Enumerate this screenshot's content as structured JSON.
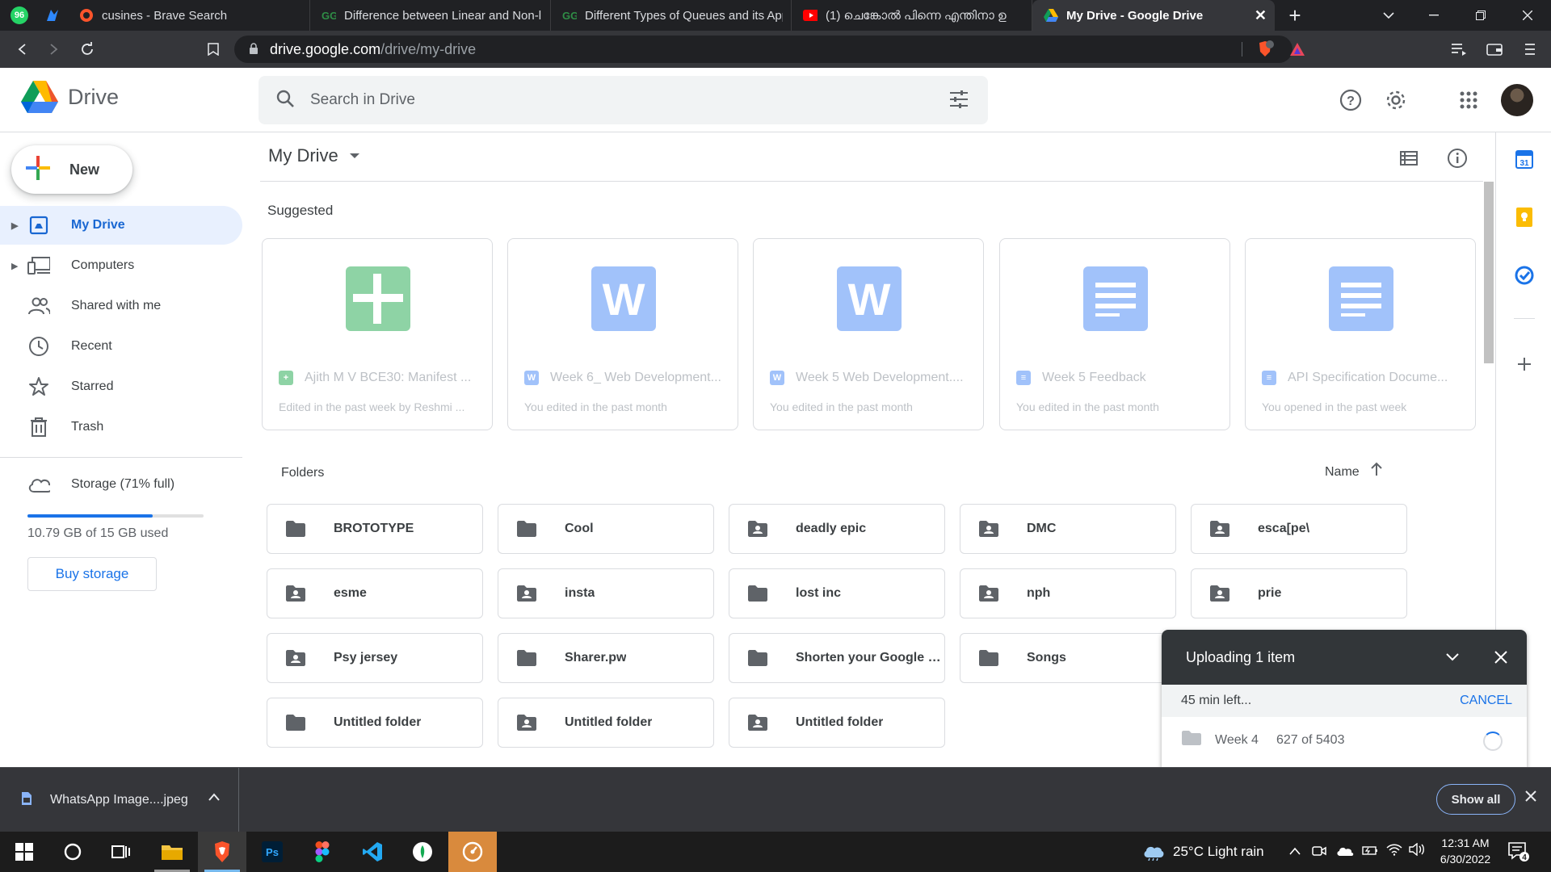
{
  "browser": {
    "tabs": [
      {
        "title": "cusines - Brave Search",
        "icon": "brave-search-icon"
      },
      {
        "title": "Difference between Linear and Non-lin",
        "icon": "gfg-icon"
      },
      {
        "title": "Different Types of Queues and its App",
        "icon": "gfg-icon"
      },
      {
        "title": "(1) ചെങ്കോൽ പിന്നെ എന്തിനാ ഉ",
        "icon": "youtube-icon"
      },
      {
        "title": "My Drive - Google Drive",
        "icon": "drive-icon",
        "active": true
      }
    ],
    "pinned": [
      "whatsapp-icon",
      "messenger-icon"
    ],
    "url_host": "drive.google.com",
    "url_path": "/drive/my-drive",
    "brave_badge": "6"
  },
  "drive": {
    "logo_text": "Drive",
    "search_placeholder": "Search in Drive",
    "new_label": "New",
    "sidebar": [
      {
        "label": "My Drive",
        "icon": "my-drive-icon",
        "active": true,
        "expandable": true
      },
      {
        "label": "Computers",
        "icon": "computers-icon",
        "expandable": true
      },
      {
        "label": "Shared with me",
        "icon": "shared-icon"
      },
      {
        "label": "Recent",
        "icon": "clock-icon"
      },
      {
        "label": "Starred",
        "icon": "star-icon"
      },
      {
        "label": "Trash",
        "icon": "trash-icon"
      }
    ],
    "storage": {
      "label": "Storage (71% full)",
      "used_text": "10.79 GB of 15 GB used",
      "percent": 71,
      "buy_label": "Buy storage"
    },
    "title": "My Drive",
    "suggested_title": "Suggested",
    "suggested": [
      {
        "name": "Ajith M V BCE30: Manifest ...",
        "sub": "Edited in the past week by Reshmi ...",
        "type": "sheets"
      },
      {
        "name": "Week 6_ Web Development...",
        "sub": "You edited in the past month",
        "type": "word"
      },
      {
        "name": "Week 5 Web Development....",
        "sub": "You edited in the past month",
        "type": "word"
      },
      {
        "name": "Week 5 Feedback",
        "sub": "You edited in the past month",
        "type": "docs"
      },
      {
        "name": "API Specification Docume...",
        "sub": "You opened in the past week",
        "type": "docs"
      }
    ],
    "folders_title": "Folders",
    "sort_label": "Name",
    "folders": [
      {
        "name": "BROTOTYPE",
        "shared": false
      },
      {
        "name": "Cool",
        "shared": false
      },
      {
        "name": "deadly epic",
        "shared": true
      },
      {
        "name": "DMC",
        "shared": true
      },
      {
        "name": "esca[pe\\",
        "shared": true
      },
      {
        "name": "esme",
        "shared": true
      },
      {
        "name": "insta",
        "shared": true
      },
      {
        "name": "lost inc",
        "shared": false
      },
      {
        "name": "nph",
        "shared": true
      },
      {
        "name": "prie",
        "shared": true
      },
      {
        "name": "Psy jersey",
        "shared": true
      },
      {
        "name": "Sharer.pw",
        "shared": false
      },
      {
        "name": "Shorten your Google Dr...",
        "shared": false
      },
      {
        "name": "Songs",
        "shared": false
      },
      {
        "name": "Untitled folder",
        "shared": false
      },
      {
        "name": "Untitled folder",
        "shared": false
      },
      {
        "name": "Untitled folder",
        "shared": true
      },
      {
        "name": "Untitled folder",
        "shared": true
      }
    ],
    "upload": {
      "title": "Uploading 1 item",
      "status": "45 min left...",
      "cancel_label": "CANCEL",
      "item_name": "Week 4",
      "item_count": "627 of 5403"
    }
  },
  "download": {
    "file": "WhatsApp Image....jpeg",
    "show_all": "Show all"
  },
  "taskbar": {
    "weather": "25°C  Light rain",
    "time": "12:31 AM",
    "date": "6/30/2022",
    "notifications": "4"
  },
  "colors": {
    "accent": "#1a73e8",
    "active_bg": "#e8f0fe",
    "chrome_dark": "#202124"
  }
}
